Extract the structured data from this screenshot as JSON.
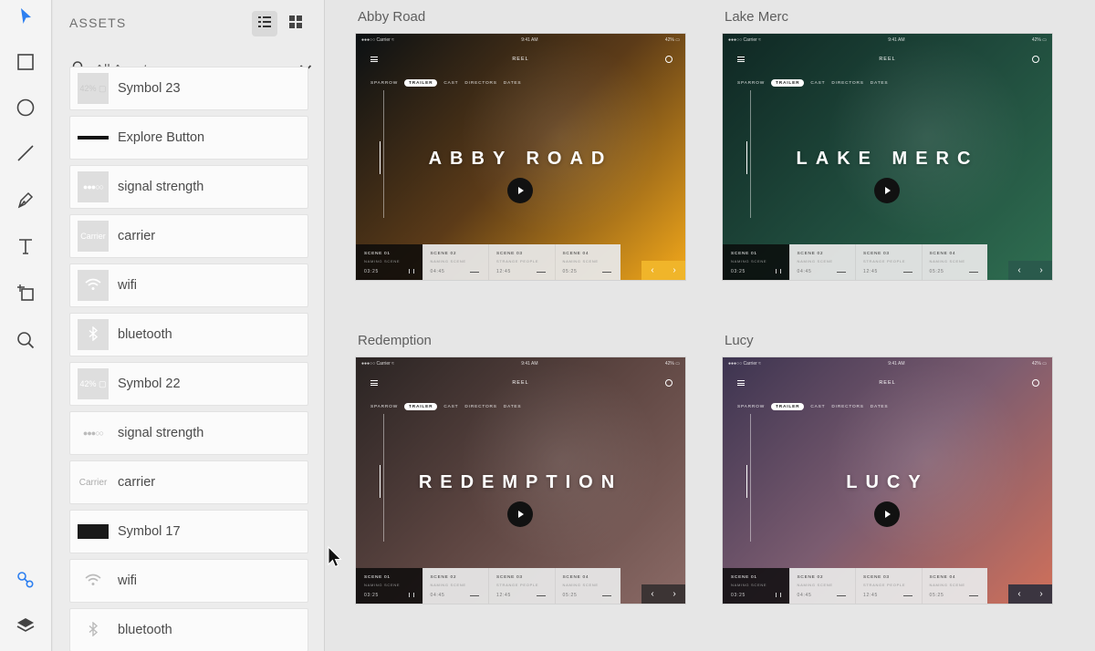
{
  "toolbar": {
    "tools": [
      {
        "name": "select-tool",
        "icon": "arrow-cursor-icon"
      },
      {
        "name": "rectangle-tool",
        "icon": "rectangle-icon"
      },
      {
        "name": "ellipse-tool",
        "icon": "ellipse-icon"
      },
      {
        "name": "line-tool",
        "icon": "line-icon"
      },
      {
        "name": "pen-tool",
        "icon": "pen-icon"
      },
      {
        "name": "text-tool",
        "icon": "text-icon"
      },
      {
        "name": "artboard-tool",
        "icon": "artboard-icon"
      },
      {
        "name": "zoom-tool",
        "icon": "magnifier-icon"
      }
    ],
    "bottom": [
      {
        "name": "assets-panel-toggle",
        "icon": "assets-icon"
      },
      {
        "name": "layers-panel-toggle",
        "icon": "layers-icon"
      }
    ]
  },
  "assets": {
    "title": "ASSETS",
    "filter_label": "All Assets",
    "items": [
      {
        "name": "Symbol 23",
        "thumb": "42% ▢"
      },
      {
        "name": "Explore Button",
        "thumb": ""
      },
      {
        "name": "signal strength",
        "thumb": "●●●○○"
      },
      {
        "name": "carrier",
        "thumb": "Carrier"
      },
      {
        "name": "wifi",
        "thumb": ""
      },
      {
        "name": "bluetooth",
        "thumb": ""
      },
      {
        "name": "Symbol 22",
        "thumb": "42% ▢"
      },
      {
        "name": "signal strength",
        "thumb": "●●●○○"
      },
      {
        "name": "carrier",
        "thumb": "Carrier"
      },
      {
        "name": "Symbol 17",
        "thumb": ""
      },
      {
        "name": "wifi",
        "thumb": ""
      },
      {
        "name": "bluetooth",
        "thumb": ""
      }
    ]
  },
  "canvas": {
    "artboards": [
      {
        "label": "Abby Road",
        "title": "ABBY ROAD",
        "colors": [
          "#0b1013",
          "#5c3b18",
          "#f2a81b"
        ],
        "arrows_bg": "#f0b52a"
      },
      {
        "label": "Lake Merc",
        "title": "LAKE MERC",
        "colors": [
          "#0f2723",
          "#1f4a3c",
          "#2f6e51"
        ],
        "arrows_bg": "#2a5a4c"
      },
      {
        "label": "Redemption",
        "title": "REDEMPTION",
        "colors": [
          "#2a2423",
          "#5e4642",
          "#8b6a66"
        ],
        "arrows_bg": "#3c3434"
      },
      {
        "label": "Lucy",
        "title": "LUCY",
        "colors": [
          "#3d3450",
          "#7b5c70",
          "#d0705a"
        ],
        "arrows_bg": "#3b3540"
      }
    ],
    "common": {
      "status_carrier": "●●●○○ Carrier ≈",
      "status_time": "9:41 AM",
      "status_battery": "42% ▭",
      "reel": "REEL",
      "nav": [
        "SPARROW",
        "TRAILER",
        "CAST",
        "DIRECTORS",
        "DATES"
      ],
      "scenes": [
        {
          "label": "SCENE 01",
          "sub": "NAMING SCENE",
          "time": "03:25"
        },
        {
          "label": "SCENE 02",
          "sub": "NAMING SCENE",
          "time": "04:45"
        },
        {
          "label": "SCENE 03",
          "sub": "STRANGE PEOPLE",
          "time": "12:45"
        },
        {
          "label": "SCENE 04",
          "sub": "NAMING SCENE",
          "time": "05:25"
        }
      ],
      "prev": "‹",
      "next": "›"
    }
  }
}
